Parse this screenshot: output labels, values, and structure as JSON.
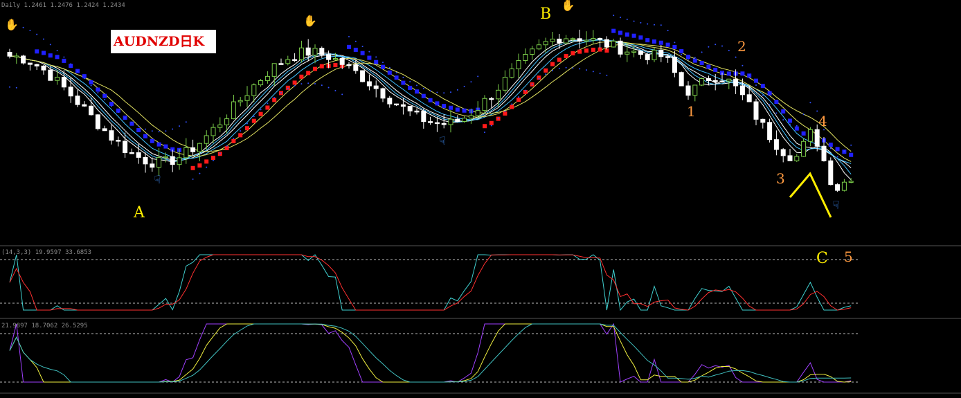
{
  "window": {
    "symbol_title": "AUDNZD日K",
    "price_header": "Daily  1.2461 1.2476 1.2424 1.2434",
    "stoch_header": "(14,3,3) 19.9597 33.6853",
    "osc_header": "21.9897 18.7062 26.5295"
  },
  "labels": [
    {
      "text": "A",
      "style": "yellow"
    },
    {
      "text": "B",
      "style": "yellow"
    },
    {
      "text": "C",
      "style": "yellow"
    },
    {
      "text": "1",
      "style": "orange"
    },
    {
      "text": "2",
      "style": "orange"
    },
    {
      "text": "3",
      "style": "orange"
    },
    {
      "text": "4",
      "style": "orange"
    },
    {
      "text": "5",
      "style": "orange"
    }
  ],
  "colors": {
    "background": "#000000",
    "bull_candle": "#7ccf4a",
    "bear_candle": "#ffffff",
    "up_trend_marks": "#ff1a1a",
    "down_trend_marks": "#2020ff",
    "sar_dots": "#3050ff",
    "ma_white": "#ffffff",
    "ma_cyan": "#40c0ff",
    "ma_yellow": "#e0e060",
    "stoch_main": "#40d0d0",
    "stoch_signal": "#ff3030",
    "osc_purple": "#a040ff",
    "osc_yellow": "#f0f040",
    "osc_cyan": "#40c0c0",
    "wave_line": "#ffee00"
  },
  "icons": [
    "fractal-up-hand-icon",
    "fractal-down-hand-icon"
  ],
  "chart_data": [
    {
      "type": "candlestick",
      "title": "AUDNZD日K",
      "y_range": [
        0,
        1
      ],
      "bars": 125,
      "key_points": [
        {
          "bar": 0,
          "level": 0.8
        },
        {
          "bar": 22,
          "level": 0.25
        },
        {
          "bar": 44,
          "level": 0.82
        },
        {
          "bar": 64,
          "level": 0.45
        },
        {
          "bar": 82,
          "level": 0.9
        },
        {
          "bar": 96,
          "level": 0.8
        },
        {
          "bar": 100,
          "level": 0.62
        },
        {
          "bar": 104,
          "level": 0.7
        },
        {
          "bar": 116,
          "level": 0.28
        },
        {
          "bar": 118,
          "level": 0.4
        },
        {
          "bar": 122,
          "level": 0.12
        },
        {
          "bar": 124,
          "level": 0.18
        }
      ],
      "moving_averages": [
        "white",
        "cyan",
        "yellow"
      ],
      "sar": true,
      "fractals": [
        0,
        22,
        44,
        64,
        82,
        122
      ]
    },
    {
      "type": "line",
      "name": "stochastic",
      "y_range": [
        0,
        100
      ],
      "levels": [
        80,
        20
      ]
    },
    {
      "type": "line",
      "name": "oscillator",
      "y_range": [
        0,
        100
      ],
      "levels": [
        80,
        20
      ]
    }
  ]
}
